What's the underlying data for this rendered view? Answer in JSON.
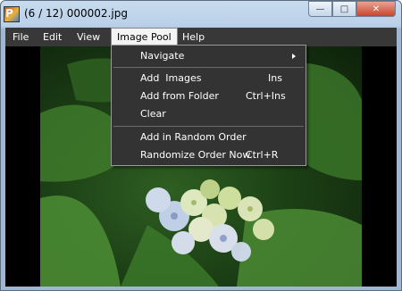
{
  "window": {
    "title": "(6 / 12) 000002.jpg",
    "buttons": {
      "minimize": "—",
      "maximize": "□",
      "close": "✕"
    }
  },
  "menubar": {
    "items": [
      {
        "label": "File"
      },
      {
        "label": "Edit"
      },
      {
        "label": "View"
      },
      {
        "label": "Image Pool",
        "active": true
      },
      {
        "label": "Help"
      }
    ]
  },
  "image_pool_menu": {
    "navigate": {
      "label": "Navigate",
      "has_submenu": true
    },
    "add_images": {
      "label": "Add  Images",
      "shortcut": "Ins"
    },
    "add_from_folder": {
      "label": "Add from Folder",
      "shortcut": "Ctrl+Ins"
    },
    "clear": {
      "label": "Clear"
    },
    "add_random": {
      "label": "Add in Random Order"
    },
    "randomize": {
      "label": "Randomize Order Now",
      "shortcut": "Ctrl+R"
    }
  },
  "photo": {
    "subject": "hydrangea-flowers"
  },
  "colors": {
    "menubar_bg": "#383838",
    "dropdown_bg": "#333333",
    "client_bg": "#000000"
  }
}
